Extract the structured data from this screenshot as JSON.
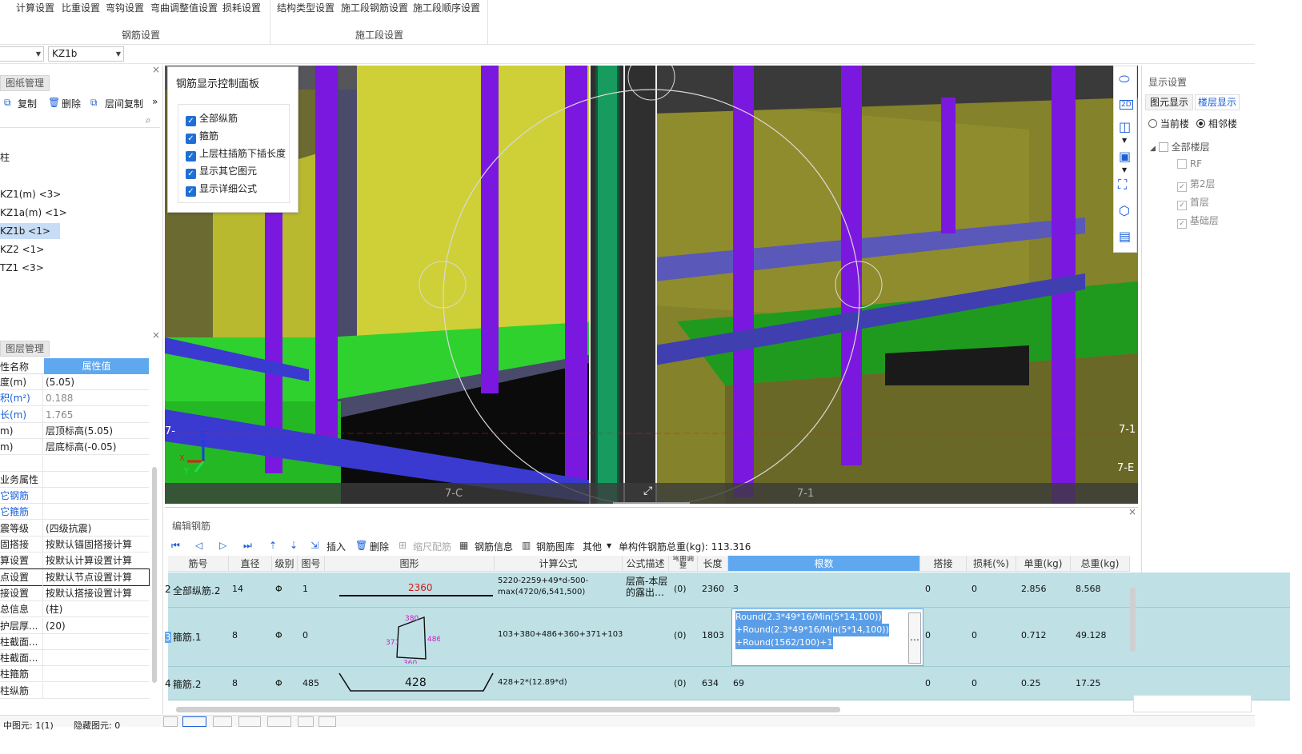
{
  "ribbon": {
    "rebar_group": {
      "buttons": [
        "计算设置",
        "比重设置",
        "弯钩设置",
        "弯曲调整值设置",
        "损耗设置"
      ],
      "label": "钢筋设置"
    },
    "stage_group": {
      "buttons": [
        "结构类型设置",
        "施工段钢筋设置",
        "施工段顺序设置"
      ],
      "label": "施工段设置"
    }
  },
  "selectors": {
    "element_value": "KZ1b"
  },
  "drawing_panel": {
    "title": "图纸管理",
    "toolbar": [
      "复制",
      "删除",
      "层间复制"
    ],
    "tree_root": "柱",
    "tree_items": [
      "KZ1(m) <3>",
      "KZ1a(m) <1>",
      "KZ1b <1>",
      "KZ2 <1>",
      "TZ1 <3>"
    ],
    "selected_item": "KZ1b <1>"
  },
  "layer_panel": {
    "title": "图层管理",
    "col_name": "性名称",
    "col_value": "属性值",
    "rows": [
      {
        "k": "度(m)",
        "v": "(5.05)",
        "kcolor": "#222",
        "vcolor": "#222"
      },
      {
        "k": "积(m²)",
        "v": "0.188",
        "kcolor": "#1a5fd6",
        "vcolor": "#888"
      },
      {
        "k": "长(m)",
        "v": "1.765",
        "kcolor": "#1a5fd6",
        "vcolor": "#888"
      },
      {
        "k": "m)",
        "v": "层顶标高(5.05)",
        "kcolor": "#222",
        "vcolor": "#222"
      },
      {
        "k": "m)",
        "v": "层底标高(-0.05)",
        "kcolor": "#222",
        "vcolor": "#222"
      },
      {
        "k": "",
        "v": "",
        "kcolor": "#222",
        "vcolor": "#222"
      },
      {
        "k": "业务属性",
        "v": "",
        "kcolor": "#222",
        "vcolor": "#222"
      },
      {
        "k": "它钢筋",
        "v": "",
        "kcolor": "#1a5fd6",
        "vcolor": "#222"
      },
      {
        "k": "它箍筋",
        "v": "",
        "kcolor": "#1a5fd6",
        "vcolor": "#222"
      },
      {
        "k": "震等级",
        "v": "(四级抗震)",
        "kcolor": "#222",
        "vcolor": "#222"
      },
      {
        "k": "固搭接",
        "v": "按默认锚固搭接计算",
        "kcolor": "#222",
        "vcolor": "#222"
      },
      {
        "k": "算设置",
        "v": "按默认计算设置计算",
        "kcolor": "#222",
        "vcolor": "#222"
      },
      {
        "k": "点设置",
        "v": "按默认节点设置计算",
        "kcolor": "#222",
        "vcolor": "#222"
      },
      {
        "k": "接设置",
        "v": "按默认搭接设置计算",
        "kcolor": "#222",
        "vcolor": "#222"
      },
      {
        "k": "总信息",
        "v": "(柱)",
        "kcolor": "#222",
        "vcolor": "#222"
      },
      {
        "k": "护层厚...",
        "v": "(20)",
        "kcolor": "#222",
        "vcolor": "#222"
      },
      {
        "k": "柱截面...",
        "v": "",
        "kcolor": "#222",
        "vcolor": "#222"
      },
      {
        "k": "柱截面...",
        "v": "",
        "kcolor": "#222",
        "vcolor": "#222"
      },
      {
        "k": "柱箍筋",
        "v": "",
        "kcolor": "#222",
        "vcolor": "#222"
      },
      {
        "k": "柱纵筋",
        "v": "",
        "kcolor": "#222",
        "vcolor": "#222"
      }
    ]
  },
  "control_panel": {
    "title": "钢筋显示控制面板",
    "options": [
      "全部纵筋",
      "箍筋",
      "上层柱插筋下插长度",
      "显示其它图元",
      "显示详细公式"
    ]
  },
  "viewport": {
    "labels": [
      "7-",
      "7-1",
      "7-E",
      "7-C",
      "7-1",
      "Z",
      "Y",
      "X"
    ]
  },
  "display_panel": {
    "title": "显示设置",
    "tabs": [
      "图元显示",
      "楼层显示"
    ],
    "radios": [
      "当前楼",
      "相邻楼"
    ],
    "tree_root": "全部楼层",
    "floors": [
      "RF",
      "第2层",
      "首层",
      "基础层"
    ]
  },
  "edit_panel": {
    "title": "编辑钢筋",
    "toolbar": [
      "插入",
      "删除",
      "缩尺配筋",
      "钢筋信息",
      "钢筋图库",
      "其他"
    ],
    "total_label": "单构件钢筋总重(kg): 113.316",
    "headers": [
      "筋号",
      "直径(mm)",
      "级别",
      "图号",
      "图形",
      "计算公式",
      "公式描述",
      "弯曲调整",
      "长度",
      "根数",
      "搭接",
      "损耗(%)",
      "单重(kg)",
      "总重(kg)"
    ],
    "rows": [
      {
        "idx": "2",
        "name": "全部纵筋.2",
        "dia": "14",
        "grade": "Φ",
        "fig": "1",
        "shape_val": "2360",
        "formula": "5220-2259+49*d-500-max(4720/6,541,500)",
        "desc": "层高-本层的露出…",
        "bend": "(0)",
        "len": "2360",
        "count": "3",
        "lap": "0",
        "loss": "0",
        "unit": "2.856",
        "total": "8.568"
      },
      {
        "idx": "3",
        "name": "箍筋.1",
        "dia": "8",
        "grade": "Φ",
        "fig": "0",
        "shape_val": "",
        "formula": "103+380+486+360+371+103",
        "desc": "",
        "bend": "(0)",
        "len": "1803",
        "count_lines": [
          "Round(2.3*49*16/Min(5*14,100))",
          "+Round(2.3*49*16/Min(5*14,100))",
          "+Round(1562/100)+1"
        ],
        "lap": "0",
        "loss": "0",
        "unit": "0.712",
        "total": "49.128"
      },
      {
        "idx": "4",
        "name": "箍筋.2",
        "dia": "8",
        "grade": "Φ",
        "fig": "485",
        "shape_val": "428",
        "formula": "428+2*(12.89*d)",
        "desc": "",
        "bend": "(0)",
        "len": "634",
        "count": "69",
        "lap": "0",
        "loss": "0",
        "unit": "0.25",
        "total": "17.25"
      }
    ],
    "stirrup_labels": [
      "380",
      "486",
      "360",
      "371"
    ]
  },
  "status": {
    "selected": "中图元: 1(1)",
    "hidden": "隐藏图元: 0"
  },
  "colors": {
    "purple": "#7b18e0",
    "green": "#2ecc2e",
    "yellow": "#c9c93a",
    "row_bg": "#bfe1e5",
    "header_sel": "#5fa8f0"
  }
}
